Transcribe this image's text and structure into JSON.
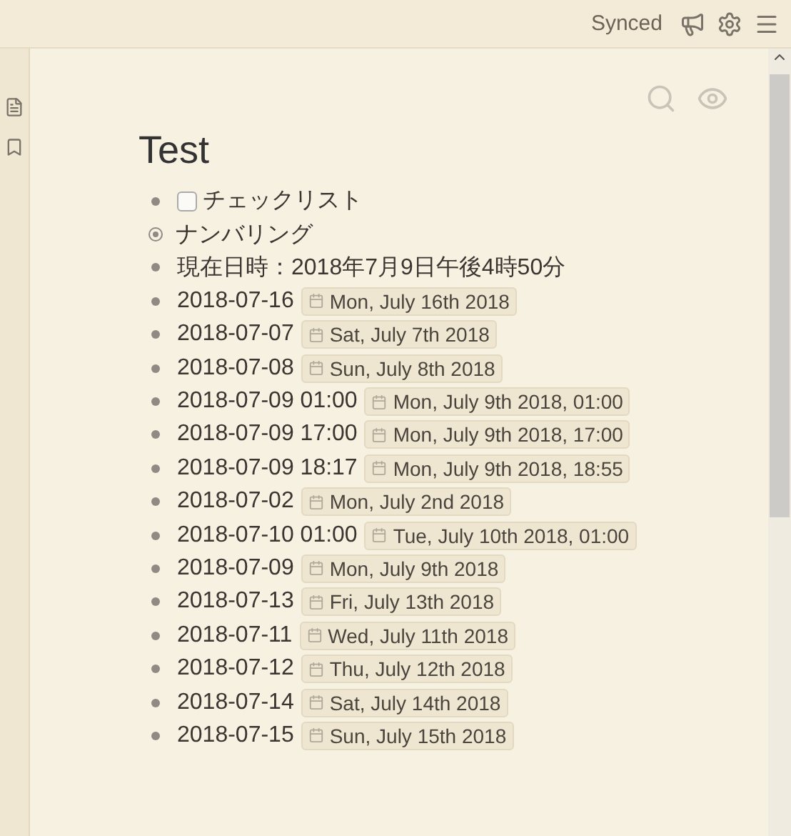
{
  "top_bar": {
    "status": "Synced"
  },
  "document": {
    "title": "Test",
    "items": [
      {
        "kind": "checkbox",
        "text": "チェックリスト",
        "checked": false
      },
      {
        "kind": "numbered",
        "text": "ナンバリング"
      },
      {
        "kind": "text",
        "text": "現在日時：2018年7月9日午後4時50分"
      },
      {
        "kind": "date",
        "text": "2018-07-16",
        "chip": "Mon, July 16th 2018"
      },
      {
        "kind": "date",
        "text": "2018-07-07",
        "chip": "Sat, July 7th 2018"
      },
      {
        "kind": "date",
        "text": "2018-07-08",
        "chip": "Sun, July 8th 2018"
      },
      {
        "kind": "date",
        "text": "2018-07-09 01:00",
        "chip": "Mon, July 9th 2018, 01:00"
      },
      {
        "kind": "date",
        "text": "2018-07-09 17:00",
        "chip": "Mon, July 9th 2018, 17:00"
      },
      {
        "kind": "date",
        "text": "2018-07-09 18:17",
        "chip": "Mon, July 9th 2018, 18:55"
      },
      {
        "kind": "date",
        "text": "2018-07-02",
        "chip": "Mon, July 2nd 2018"
      },
      {
        "kind": "date",
        "text": "2018-07-10 01:00",
        "chip": "Tue, July 10th 2018, 01:00"
      },
      {
        "kind": "date",
        "text": "2018-07-09",
        "chip": "Mon, July 9th 2018"
      },
      {
        "kind": "date",
        "text": "2018-07-13",
        "chip": "Fri, July 13th 2018"
      },
      {
        "kind": "date",
        "text": "2018-07-11",
        "chip": "Wed, July 11th 2018"
      },
      {
        "kind": "date",
        "text": "2018-07-12",
        "chip": "Thu, July 12th 2018"
      },
      {
        "kind": "date",
        "text": "2018-07-14",
        "chip": "Sat, July 14th 2018"
      },
      {
        "kind": "date",
        "text": "2018-07-15",
        "chip": "Sun, July 15th 2018"
      }
    ]
  }
}
